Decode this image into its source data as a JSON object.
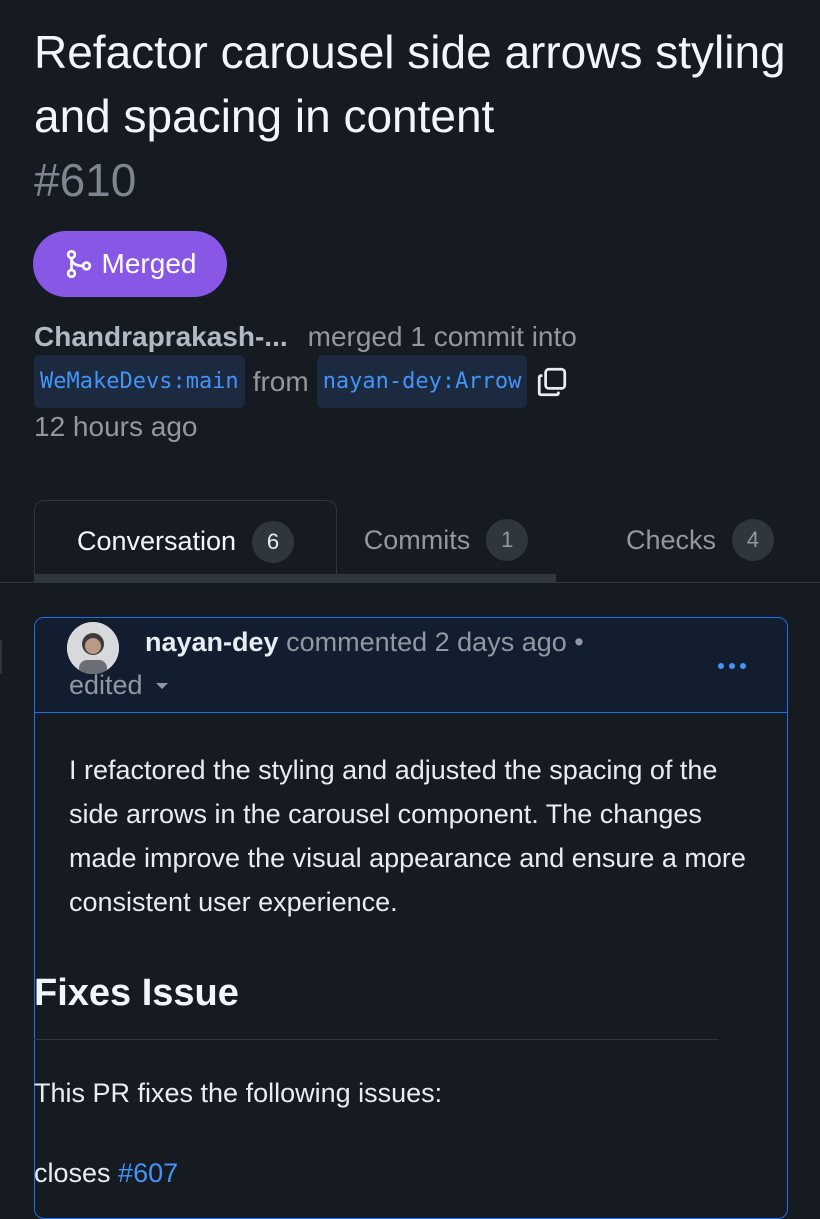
{
  "pr": {
    "title": "Refactor carousel side arrows styling and spacing in content",
    "number": "#610",
    "status": "Merged",
    "status_color": "#8957e5",
    "author": "Chandraprakash-...",
    "action": "merged 1 commit into",
    "base_branch": "WeMakeDevs:main",
    "from_label": "from",
    "head_branch": "nayan-dey:Arrow",
    "time": "12 hours ago"
  },
  "tabs": [
    {
      "label": "Conversation",
      "count": "6"
    },
    {
      "label": "Commits",
      "count": "1"
    },
    {
      "label": "Checks",
      "count": "4"
    }
  ],
  "comment": {
    "user": "nayan-dey",
    "action": "commented 2 days ago •",
    "edited_label": "edited",
    "body": "I refactored the styling and adjusted the spacing of the side arrows in the carousel component. The changes made improve the visual appearance and ensure a more consistent user experience.",
    "heading": "Fixes Issue",
    "fixes_text": "This PR fixes the following issues:",
    "closes_label": "closes",
    "closes_link": "#607"
  },
  "icons": {
    "merge": "git-merge-icon",
    "copy": "copy-icon",
    "more": "kebab-horizontal-icon",
    "caret": "triangle-down-icon"
  },
  "colors": {
    "background": "#161b22",
    "link": "#4493f8",
    "muted": "#9198a1"
  }
}
